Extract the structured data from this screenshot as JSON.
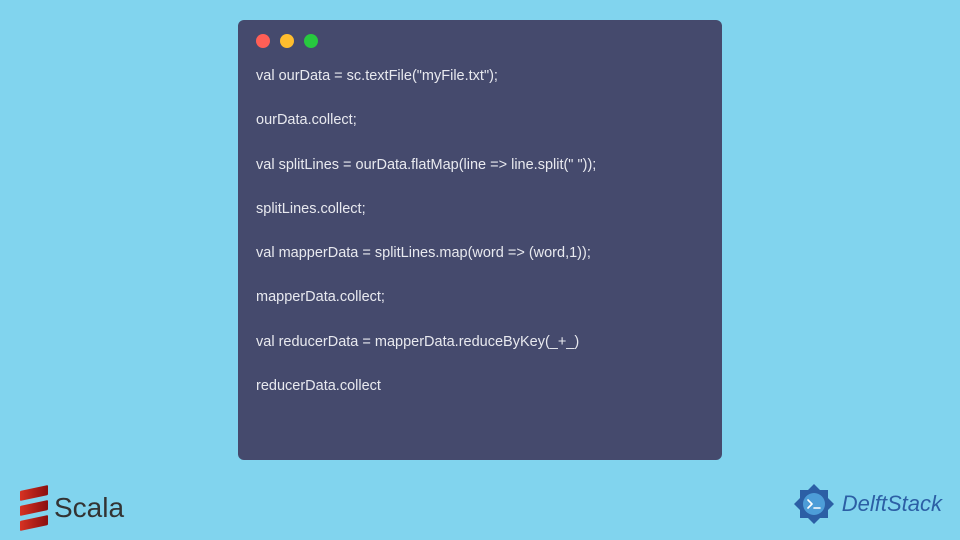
{
  "code": {
    "lines": [
      "val ourData = sc.textFile(\"myFile.txt\");",
      "ourData.collect;",
      "val splitLines = ourData.flatMap(line => line.split(\" \"));",
      "splitLines.collect;",
      "val mapperData = splitLines.map(word => (word,1));",
      "mapperData.collect;",
      "val reducerData = mapperData.reduceByKey(_+_)",
      "reducerData.collect"
    ]
  },
  "logos": {
    "scala": "Scala",
    "delft": "DelftStack"
  }
}
